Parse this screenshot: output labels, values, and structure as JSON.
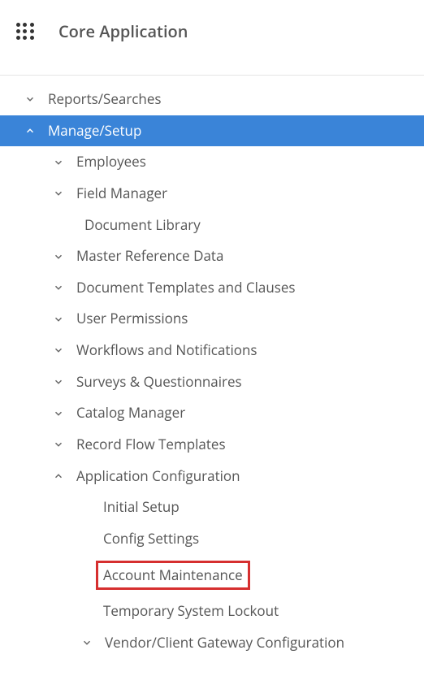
{
  "header": {
    "title": "Core Application"
  },
  "nav": {
    "reports_searches": "Reports/Searches",
    "manage_setup": "Manage/Setup",
    "employees": "Employees",
    "field_manager": "Field Manager",
    "document_library": "Document Library",
    "master_reference_data": "Master Reference Data",
    "document_templates": "Document Templates and Clauses",
    "user_permissions": "User Permissions",
    "workflows_notifications": "Workflows and Notifications",
    "surveys_questionnaires": "Surveys & Questionnaires",
    "catalog_manager": "Catalog Manager",
    "record_flow_templates": "Record Flow Templates",
    "application_configuration": "Application Configuration",
    "initial_setup": "Initial Setup",
    "config_settings": "Config Settings",
    "account_maintenance": "Account Maintenance",
    "temporary_system_lockout": "Temporary System Lockout",
    "vendor_client_gateway": "Vendor/Client Gateway Configuration"
  }
}
